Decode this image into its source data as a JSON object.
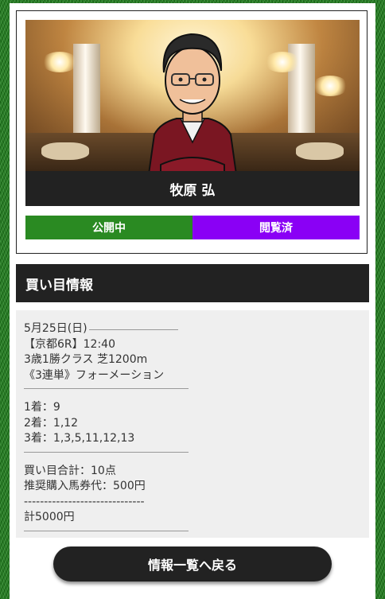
{
  "profile": {
    "name": "牧原 弘",
    "status_public": "公開中",
    "status_viewed": "閲覧済"
  },
  "section": {
    "title": "買い目情報"
  },
  "info": {
    "date": "5月25日(日)",
    "race": "【京都6R】12:40",
    "race_class": "3歳1勝クラス 芝1200m",
    "bet_type": "《3連単》フォーメーション",
    "first": "1着：9",
    "second": "2着：1,12",
    "third": "3着：1,3,5,11,12,13",
    "total_points": "買い目合計：10点",
    "recommended": "推奨購入馬券代：500円",
    "dashes": "------------------------------",
    "total_amount": "計5000円"
  },
  "footer": {
    "back_label": "情報一覧へ戻る"
  },
  "colors": {
    "public": "#2a8a22",
    "viewed": "#8a00f5",
    "dark": "#222222"
  }
}
